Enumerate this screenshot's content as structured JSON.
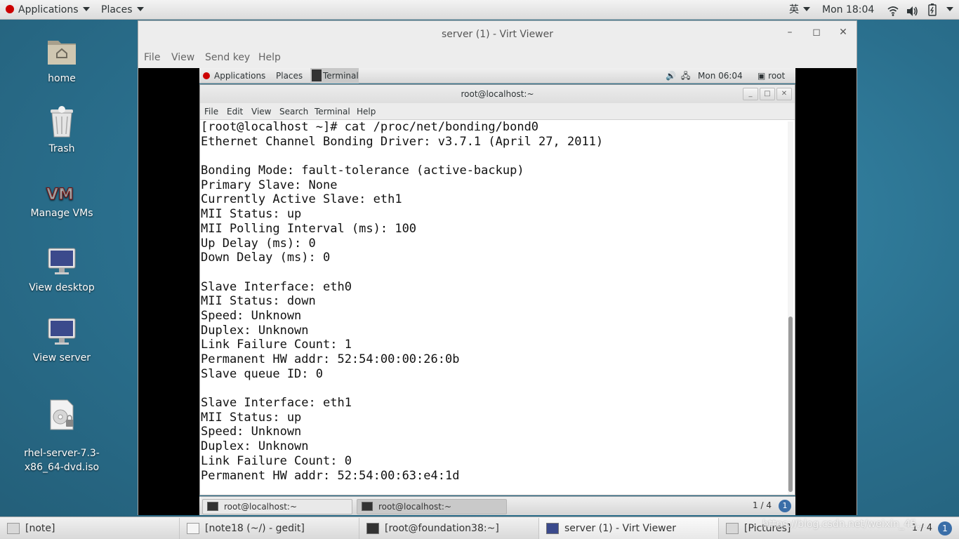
{
  "host_topbar": {
    "applications": "Applications",
    "places": "Places",
    "input_method": "英",
    "clock": "Mon 18:04"
  },
  "desktop_icons": [
    {
      "label": "home"
    },
    {
      "label": "Trash"
    },
    {
      "label": "Manage VMs"
    },
    {
      "label": "View desktop"
    },
    {
      "label": "View server"
    },
    {
      "label": "rhel-server-7.3-\nx86_64-dvd.iso"
    }
  ],
  "virt_viewer": {
    "title": "server (1) - Virt Viewer",
    "menu": [
      "File",
      "View",
      "Send key",
      "Help"
    ]
  },
  "guest_topbar": {
    "applications": "Applications",
    "places": "Places",
    "terminal": "Terminal",
    "clock": "Mon 06:04",
    "user": "root"
  },
  "terminal": {
    "title": "root@localhost:~",
    "menu": [
      "File",
      "Edit",
      "View",
      "Search",
      "Terminal",
      "Help"
    ],
    "lines": [
      "[root@localhost ~]# cat /proc/net/bonding/bond0",
      "Ethernet Channel Bonding Driver: v3.7.1 (April 27, 2011)",
      "",
      "Bonding Mode: fault-tolerance (active-backup)",
      "Primary Slave: None",
      "Currently Active Slave: eth1",
      "MII Status: up",
      "MII Polling Interval (ms): 100",
      "Up Delay (ms): 0",
      "Down Delay (ms): 0",
      "",
      "Slave Interface: eth0",
      "MII Status: down",
      "Speed: Unknown",
      "Duplex: Unknown",
      "Link Failure Count: 1",
      "Permanent HW addr: 52:54:00:00:26:0b",
      "Slave queue ID: 0",
      "",
      "Slave Interface: eth1",
      "MII Status: up",
      "Speed: Unknown",
      "Duplex: Unknown",
      "Link Failure Count: 0",
      "Permanent HW addr: 52:54:00:63:e4:1d"
    ]
  },
  "guest_taskbar": {
    "tasks": [
      "root@localhost:~",
      "root@localhost:~"
    ],
    "workspace": "1 / 4",
    "notification": "1"
  },
  "host_taskbar": {
    "tasks": [
      "[note]",
      "[note18 (~/) - gedit]",
      "[root@foundation38:~]",
      "server (1) - Virt Viewer",
      "[Pictures]"
    ],
    "workspace": "1 / 4",
    "notification": "1"
  },
  "watermark": "https://blog.csdn.net/weixin_45...",
  "colors": {
    "desktop_bg": "#2f7a99",
    "redhat_red": "#cc0000",
    "terminal_bg": "#ffffff",
    "terminal_fg": "#111111"
  }
}
